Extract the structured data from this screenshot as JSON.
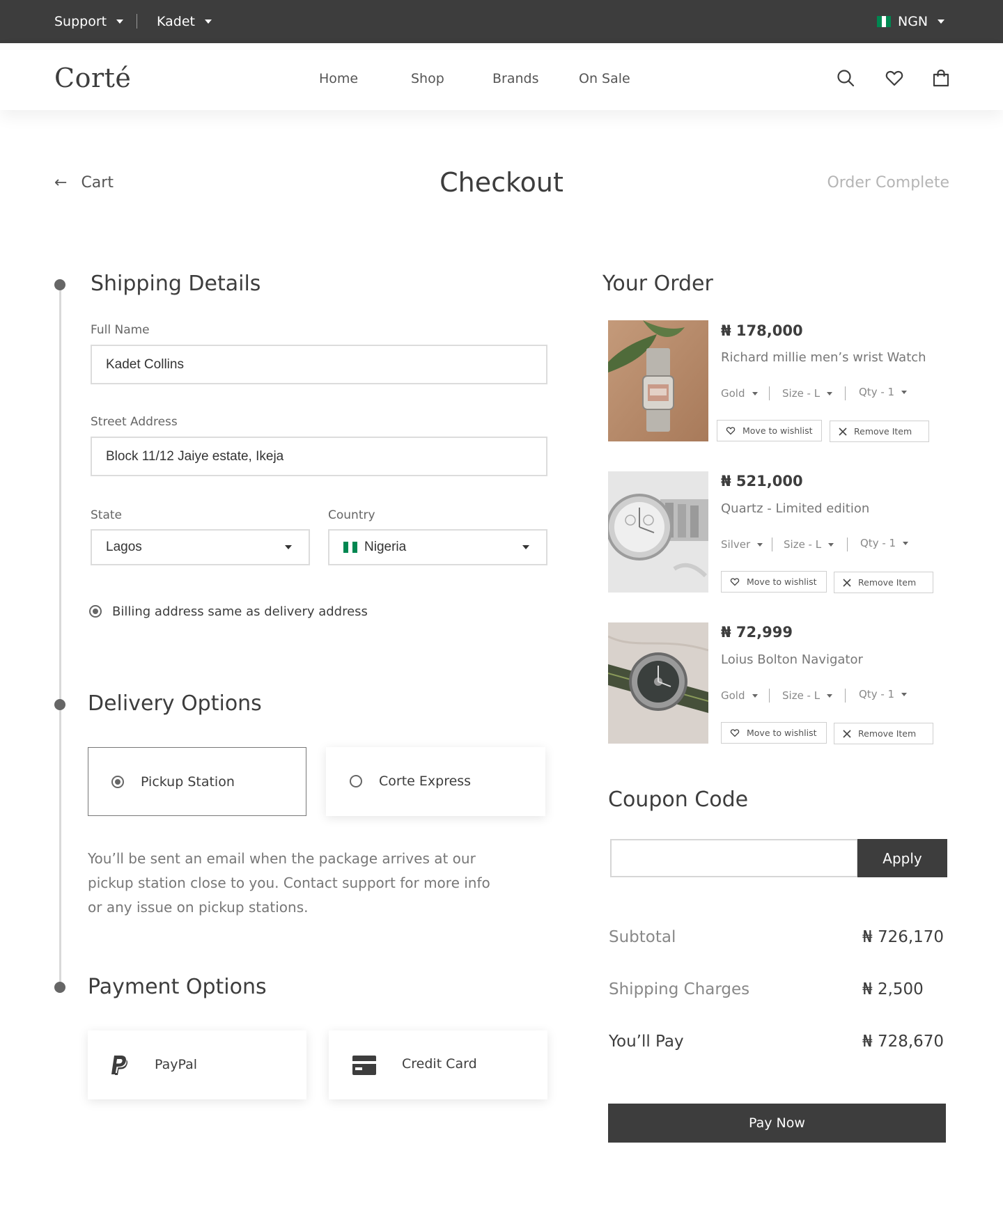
{
  "topbar": {
    "support_label": "Support",
    "account_label": "Kadet",
    "currency_label": "NGN"
  },
  "header": {
    "logo": "Corté",
    "nav": [
      "Home",
      "Shop",
      "Brands",
      "On Sale"
    ]
  },
  "page": {
    "back_label": "Cart",
    "title": "Checkout",
    "next_step": "Order Complete"
  },
  "shipping": {
    "title": "Shipping Details",
    "full_name_label": "Full Name",
    "full_name_value": "Kadet Collins",
    "street_label": "Street Address",
    "street_value": "Block 11/12 Jaiye estate, Ikeja",
    "state_label": "State",
    "state_value": "Lagos",
    "country_label": "Country",
    "country_value": "Nigeria",
    "billing_same_label": "Billing address same as delivery address",
    "billing_same_checked": true
  },
  "delivery": {
    "title": "Delivery Options",
    "options": [
      {
        "label": "Pickup Station",
        "selected": true
      },
      {
        "label": "Corte Express",
        "selected": false
      }
    ],
    "description": "You’ll be sent an email when the package arrives at our pickup station close to you. Contact support for more info or any issue on pickup stations."
  },
  "payment": {
    "title": "Payment Options",
    "options": [
      {
        "label": "PayPal",
        "icon": "paypal-icon"
      },
      {
        "label": "Credit Card",
        "icon": "credit-card-icon"
      }
    ]
  },
  "order": {
    "title": "Your Order",
    "items": [
      {
        "price": "₦ 178,000",
        "name": "Richard millie men’s wrist Watch",
        "color": "Gold",
        "size": "Size - L",
        "qty": "Qty - 1",
        "wishlist_label": "Move to wishlist",
        "remove_label": "Remove Item"
      },
      {
        "price": "₦ 521,000",
        "name": "Quartz  - Limited edition",
        "color": "Silver",
        "size": "Size - L",
        "qty": "Qty - 1",
        "wishlist_label": "Move to wishlist",
        "remove_label": "Remove Item"
      },
      {
        "price": "₦ 72,999",
        "name": "Loius Bolton Navigator",
        "color": "Gold",
        "size": "Size - L",
        "qty": "Qty - 1",
        "wishlist_label": "Move to wishlist",
        "remove_label": "Remove Item"
      }
    ]
  },
  "coupon": {
    "title": "Coupon Code",
    "value": "",
    "apply_label": "Apply"
  },
  "totals": {
    "subtotal_label": "Subtotal",
    "subtotal_value": "₦ 726,170",
    "shipping_label": "Shipping Charges",
    "shipping_value": "₦ 2,500",
    "pay_label": "You’ll Pay",
    "pay_value": "₦ 728,670"
  },
  "pay_now_label": "Pay Now",
  "colors": {
    "dark": "#3d3d3d",
    "muted": "#888888",
    "border": "#dcdcdc",
    "flag_green": "#008751"
  }
}
